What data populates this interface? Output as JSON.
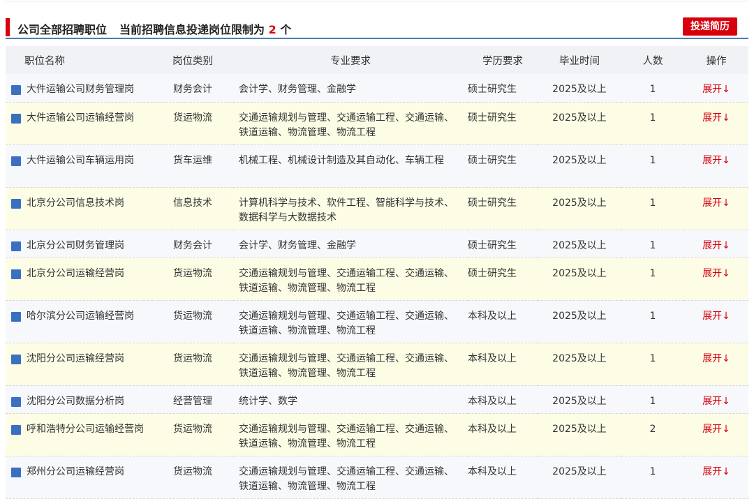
{
  "header": {
    "title": "公司全部招聘职位",
    "limit_prefix": "当前招聘信息投递岗位限制为",
    "limit_count": "2",
    "limit_suffix": "个",
    "apply_button": "投递简历"
  },
  "colors": {
    "accent": "#d8000c",
    "bullet": "#3b70c0",
    "header_line": "#4a7fb5"
  },
  "table": {
    "columns": [
      "职位名称",
      "岗位类别",
      "专业要求",
      "学历要求",
      "毕业时间",
      "人数",
      "操作"
    ],
    "action_label": "展开↓",
    "rows": [
      {
        "name": "大件运输公司财务管理岗",
        "category": "财务会计",
        "major": "会计学、财务管理、金融学",
        "education": "硕士研究生",
        "graduation": "2025及以上",
        "count": "1"
      },
      {
        "name": "大件运输公司运输经营岗",
        "category": "货运物流",
        "major": "交通运输规划与管理、交通运输工程、交通运输、铁道运输、物流管理、物流工程",
        "education": "硕士研究生",
        "graduation": "2025及以上",
        "count": "1"
      },
      {
        "name": "大件运输公司车辆运用岗",
        "category": "货车运维",
        "major": "机械工程、机械设计制造及其自动化、车辆工程",
        "education": "硕士研究生",
        "graduation": "2025及以上",
        "count": "1"
      },
      {
        "name": "北京分公司信息技术岗",
        "category": "信息技术",
        "major": "计算机科学与技术、软件工程、智能科学与技术、数据科学与大数据技术",
        "education": "硕士研究生",
        "graduation": "2025及以上",
        "count": "1"
      },
      {
        "name": "北京分公司财务管理岗",
        "category": "财务会计",
        "major": "会计学、财务管理、金融学",
        "education": "硕士研究生",
        "graduation": "2025及以上",
        "count": "1"
      },
      {
        "name": "北京分公司运输经营岗",
        "category": "货运物流",
        "major": "交通运输规划与管理、交通运输工程、交通运输、铁道运输、物流管理、物流工程",
        "education": "硕士研究生",
        "graduation": "2025及以上",
        "count": "1"
      },
      {
        "name": "哈尔滨分公司运输经营岗",
        "category": "货运物流",
        "major": "交通运输规划与管理、交通运输工程、交通运输、铁道运输、物流管理、物流工程",
        "education": "本科及以上",
        "graduation": "2025及以上",
        "count": "1"
      },
      {
        "name": "沈阳分公司运输经营岗",
        "category": "货运物流",
        "major": "交通运输规划与管理、交通运输工程、交通运输、铁道运输、物流管理、物流工程",
        "education": "本科及以上",
        "graduation": "2025及以上",
        "count": "1"
      },
      {
        "name": "沈阳分公司数据分析岗",
        "category": "经营管理",
        "major": "统计学、数学",
        "education": "本科及以上",
        "graduation": "2025及以上",
        "count": "1"
      },
      {
        "name": "呼和浩特分公司运输经营岗",
        "category": "货运物流",
        "major": "交通运输规划与管理、交通运输工程、交通运输、铁道运输、物流管理、物流工程",
        "education": "本科及以上",
        "graduation": "2025及以上",
        "count": "2"
      },
      {
        "name": "郑州分公司运输经营岗",
        "category": "货运物流",
        "major": "交通运输规划与管理、交通运输工程、交通运输、铁道运输、物流管理、物流工程",
        "education": "本科及以上",
        "graduation": "2025及以上",
        "count": "1"
      }
    ]
  }
}
